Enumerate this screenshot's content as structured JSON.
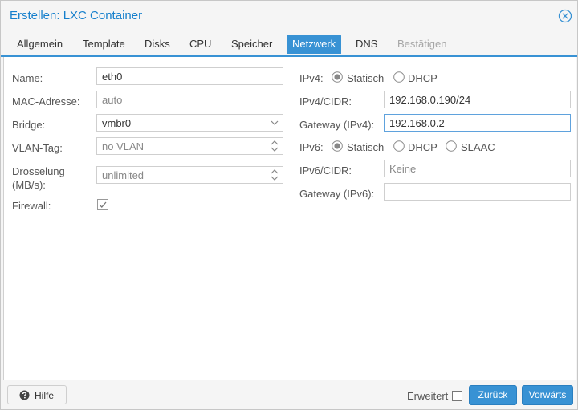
{
  "window": {
    "title": "Erstellen: LXC Container"
  },
  "tabs": [
    {
      "label": "Allgemein",
      "state": "normal"
    },
    {
      "label": "Template",
      "state": "normal"
    },
    {
      "label": "Disks",
      "state": "normal"
    },
    {
      "label": "CPU",
      "state": "normal"
    },
    {
      "label": "Speicher",
      "state": "normal"
    },
    {
      "label": "Netzwerk",
      "state": "active"
    },
    {
      "label": "DNS",
      "state": "normal"
    },
    {
      "label": "Bestätigen",
      "state": "disabled"
    }
  ],
  "left": {
    "name": {
      "label": "Name:",
      "value": "eth0"
    },
    "mac": {
      "label": "MAC-Adresse:",
      "placeholder": "auto"
    },
    "bridge": {
      "label": "Bridge:",
      "value": "vmbr0"
    },
    "vlan": {
      "label": "VLAN-Tag:",
      "placeholder": "no VLAN"
    },
    "rate": {
      "label_line1": "Drosselung",
      "label_line2": "(MB/s):",
      "placeholder": "unlimited"
    },
    "firewall": {
      "label": "Firewall:",
      "checked": true
    }
  },
  "right": {
    "ipv4": {
      "label": "IPv4:",
      "options": [
        "Statisch",
        "DHCP"
      ],
      "selected": "Statisch"
    },
    "ipv4_cidr": {
      "label": "IPv4/CIDR:",
      "value": "192.168.0.190/24"
    },
    "gateway4": {
      "label": "Gateway (IPv4):",
      "value": "192.168.0.2"
    },
    "ipv6": {
      "label": "IPv6:",
      "options": [
        "Statisch",
        "DHCP",
        "SLAAC"
      ],
      "selected": "Statisch"
    },
    "ipv6_cidr": {
      "label": "IPv6/CIDR:",
      "placeholder": "Keine"
    },
    "gateway6": {
      "label": "Gateway (IPv6):",
      "value": ""
    }
  },
  "footer": {
    "help_label": "Hilfe",
    "advanced_label": "Erweitert",
    "advanced_checked": false,
    "back_label": "Zurück",
    "next_label": "Vorwärts"
  },
  "colors": {
    "accent": "#3892d4",
    "title": "#157fcc",
    "muted": "#888888"
  }
}
